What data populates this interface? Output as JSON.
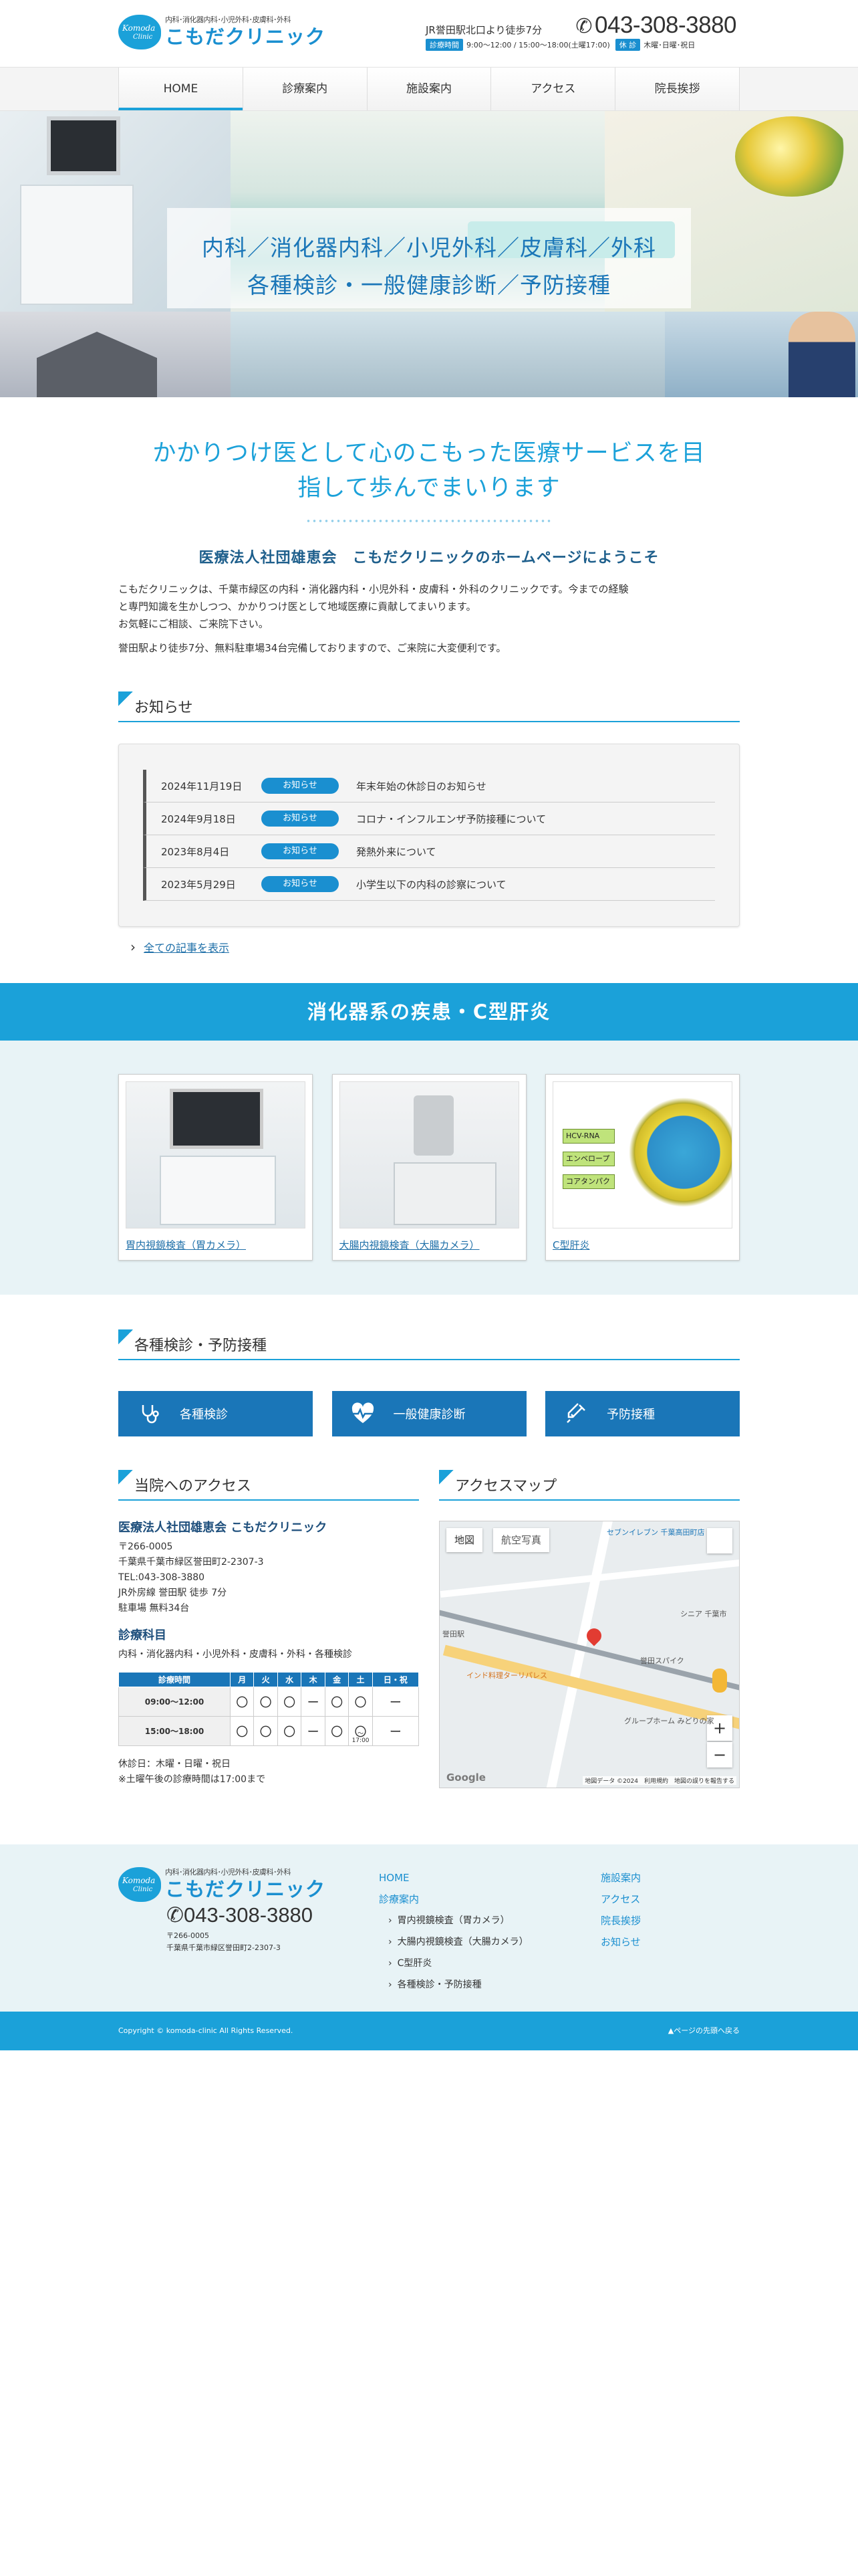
{
  "header": {
    "logo_sub": "内科･消化器内科･小児外科･皮膚科･外科",
    "logo_main": "こもだクリニック",
    "logo_en1": "Komoda",
    "logo_en2": "Clinic",
    "access": "JR誉田駅北口より徒歩7分",
    "tel": "043-308-3880",
    "hours_label": "診療時間",
    "hours_value": "9:00～12:00 / 15:00～18:00(土曜17:00)",
    "closed_label": "休 診",
    "closed_value": "木曜･日曜･祝日"
  },
  "nav": [
    "HOME",
    "診療案内",
    "施設案内",
    "アクセス",
    "院長挨拶"
  ],
  "hero": {
    "line1": "内科／消化器内科／小児外科／皮膚科／外科",
    "line2": "各種検診・一般健康診断／予防接種"
  },
  "intro": {
    "lead_line1": "かかりつけ医として心のこもった医療サービスを目",
    "lead_line2": "指して歩んでまいります",
    "welcome": "医療法人社団雄恵会　こもだクリニックのホームページにようこそ",
    "p1_line1": "こもだクリニックは、千葉市緑区の内科・消化器内科・小児外科・皮膚科・外科のクリニックです。今までの経験",
    "p1_line2": "と専門知識を生かしつつ、かかりつけ医として地域医療に貢献してまいります。",
    "p1_line3": "お気軽にご相談、ご来院下さい。",
    "p2": "誉田駅より徒歩7分、無料駐車場34台完備しておりますので、ご来院に大変便利です。"
  },
  "news": {
    "heading": "お知らせ",
    "items": [
      {
        "date": "2024年11月19日",
        "category": "お知らせ",
        "title": "年末年始の休診日のお知らせ"
      },
      {
        "date": "2024年9月18日",
        "category": "お知らせ",
        "title": "コロナ・インフルエンザ予防接種について"
      },
      {
        "date": "2023年8月4日",
        "category": "お知らせ",
        "title": "発熱外来について"
      },
      {
        "date": "2023年5月29日",
        "category": "お知らせ",
        "title": "小学生以下の内科の診察について"
      }
    ],
    "more": "全ての記事を表示"
  },
  "digestive": {
    "heading": "消化器系の疾患・C型肝炎",
    "cards": [
      {
        "caption": "胃内視鏡検査（胃カメラ）"
      },
      {
        "caption": "大腸内視鏡検査（大腸カメラ）"
      },
      {
        "caption": "C型肝炎"
      }
    ],
    "virus_labels": [
      "HCV-RNA",
      "エンベロープ",
      "コアタンパク"
    ]
  },
  "checkup": {
    "heading": "各種検診・予防接種",
    "buttons": [
      "各種検診",
      "一般健康診断",
      "予防接種"
    ],
    "icons": [
      "stethoscope-icon",
      "heartbeat-icon",
      "syringe-icon"
    ]
  },
  "access": {
    "heading": "当院へのアクセス",
    "name": "医療法人社団雄恵会 こもだクリニック",
    "lines": [
      "〒266-0005",
      "千葉県千葉市緑区誉田町2-2307-3",
      "TEL:043-308-3880",
      "JR外房線 誉田駅 徒歩 7分",
      "駐車場 無料34台"
    ],
    "dept_heading": "診療科目",
    "dept": "内科・消化器内科・小児外科・皮膚科・外科・各種検診",
    "table_head": [
      "診療時間",
      "月",
      "火",
      "水",
      "木",
      "金",
      "土",
      "日・祝"
    ],
    "rows": [
      {
        "time": "09:00～12:00",
        "cells": [
          "〇",
          "〇",
          "〇",
          "ー",
          "〇",
          "〇",
          "ー"
        ]
      },
      {
        "time": "15:00～18:00",
        "cells": [
          "〇",
          "〇",
          "〇",
          "ー",
          "〇",
          "〇",
          "ー"
        ],
        "sat_note": "～17:00"
      }
    ],
    "closed": "休診日：木曜・日曜・祝日",
    "saturday": "※土曜午後の診療時間は17:00まで"
  },
  "map": {
    "heading": "アクセスマップ",
    "tab_map": "地図",
    "tab_sat": "航空写真",
    "places": [
      "セブンイレブン 千葉高田町店",
      "誉田駅",
      "インド料理ターリパレス",
      "誉田スパイク",
      "グループホーム みどりの家",
      "シニア 千葉市"
    ],
    "attribution": "地図データ ©2024　利用規約　地図の誤りを報告する",
    "google": "Google"
  },
  "footer": {
    "logo_sub": "内科･消化器内科･小児外科･皮膚科･外科",
    "logo_main": "こもだクリニック",
    "tel": "043-308-3880",
    "zip": "〒266-0005",
    "address": "千葉県千葉市緑区誉田町2-2307-3",
    "nav1": [
      "HOME",
      "診療案内"
    ],
    "nav1_sub": [
      "胃内視鏡検査（胃カメラ）",
      "大腸内視鏡検査（大腸カメラ）",
      "C型肝炎",
      "各種検診・予防接種"
    ],
    "nav2": [
      "施設案内",
      "アクセス",
      "院長挨拶",
      "お知らせ"
    ],
    "copyright": "Copyright © komoda-clinic All Rights Reserved.",
    "pagetop": "▲ページの先頭へ戻る"
  },
  "colors": {
    "accent": "#1ba1d9",
    "dark_blue": "#1a76b8",
    "band_bg": "#e8f3f6"
  }
}
